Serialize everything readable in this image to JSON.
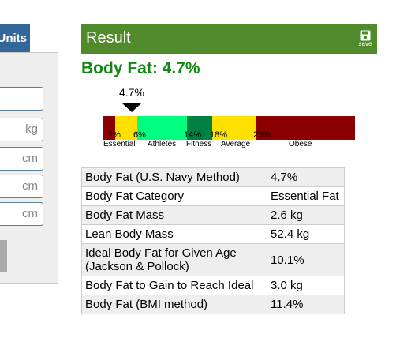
{
  "left_form": {
    "units_tab_label": "Units",
    "fields": [
      {
        "unit": ""
      },
      {
        "unit": "kg"
      },
      {
        "unit": "cm"
      },
      {
        "unit": "cm"
      },
      {
        "unit": "cm"
      }
    ]
  },
  "result": {
    "header_title": "Result",
    "save_label": "save",
    "headline": "Body Fat: 4.7%",
    "pointer_label": "4.7%",
    "body_fat_value": 4.7,
    "scale": {
      "ticks": [
        "2%",
        "6%",
        "14%",
        "18%",
        "25%"
      ],
      "categories": [
        "Essential",
        "Athletes",
        "Fitness",
        "Average",
        "Obese"
      ],
      "colors": {
        "essential": "#8b0000",
        "yellow": "#ffe000",
        "athletes": "#00ff7f",
        "fitness": "#008040",
        "average": "#ffe000",
        "obese": "#8b0000"
      }
    },
    "table": [
      {
        "label": "Body Fat (U.S. Navy Method)",
        "value": "4.7%"
      },
      {
        "label": "Body Fat Category",
        "value": "Essential Fat"
      },
      {
        "label": "Body Fat Mass",
        "value": "2.6 kg"
      },
      {
        "label": "Lean Body Mass",
        "value": "52.4 kg"
      },
      {
        "label": "Ideal Body Fat for Given Age (Jackson & Pollock)",
        "value": "10.1%"
      },
      {
        "label": "Body Fat to Gain to Reach Ideal",
        "value": "3.0 kg"
      },
      {
        "label": "Body Fat (BMI method)",
        "value": "11.4%"
      }
    ]
  }
}
